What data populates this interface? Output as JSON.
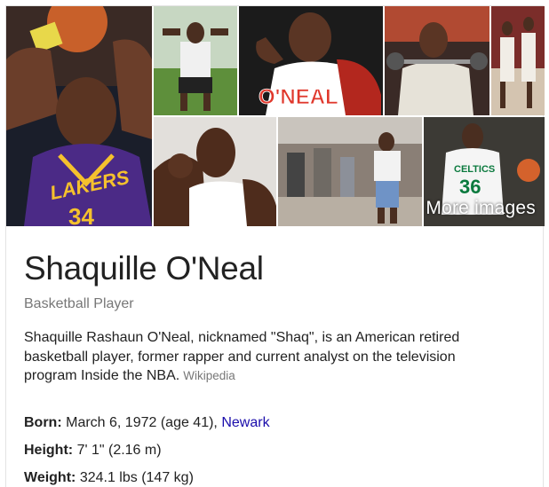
{
  "gallery": {
    "more_images_label": "More images",
    "overlay_text": "O'NEAL",
    "jersey_text": "LAKERS",
    "jersey_number": "34",
    "celtics_text": "CELTICS",
    "celtics_number": "36"
  },
  "entity": {
    "name": "Shaquille O'Neal",
    "type": "Basketball Player",
    "description": "Shaquille Rashaun O'Neal, nicknamed \"Shaq\", is an American retired basketball player, former rapper and current analyst on the television program Inside the NBA.",
    "description_source": "Wikipedia"
  },
  "facts": {
    "born_label": "Born:",
    "born_value": "March 6, 1972 (age 41),",
    "born_link": "Newark",
    "height_label": "Height:",
    "height_value": "7' 1\" (2.16 m)",
    "weight_label": "Weight:",
    "weight_value": "324.1 lbs (147 kg)"
  },
  "colors": {
    "link": "#1a0dab",
    "lakers_purple": "#4b2a86",
    "lakers_gold": "#f5c12d",
    "celtics_green": "#0b7a3e"
  }
}
